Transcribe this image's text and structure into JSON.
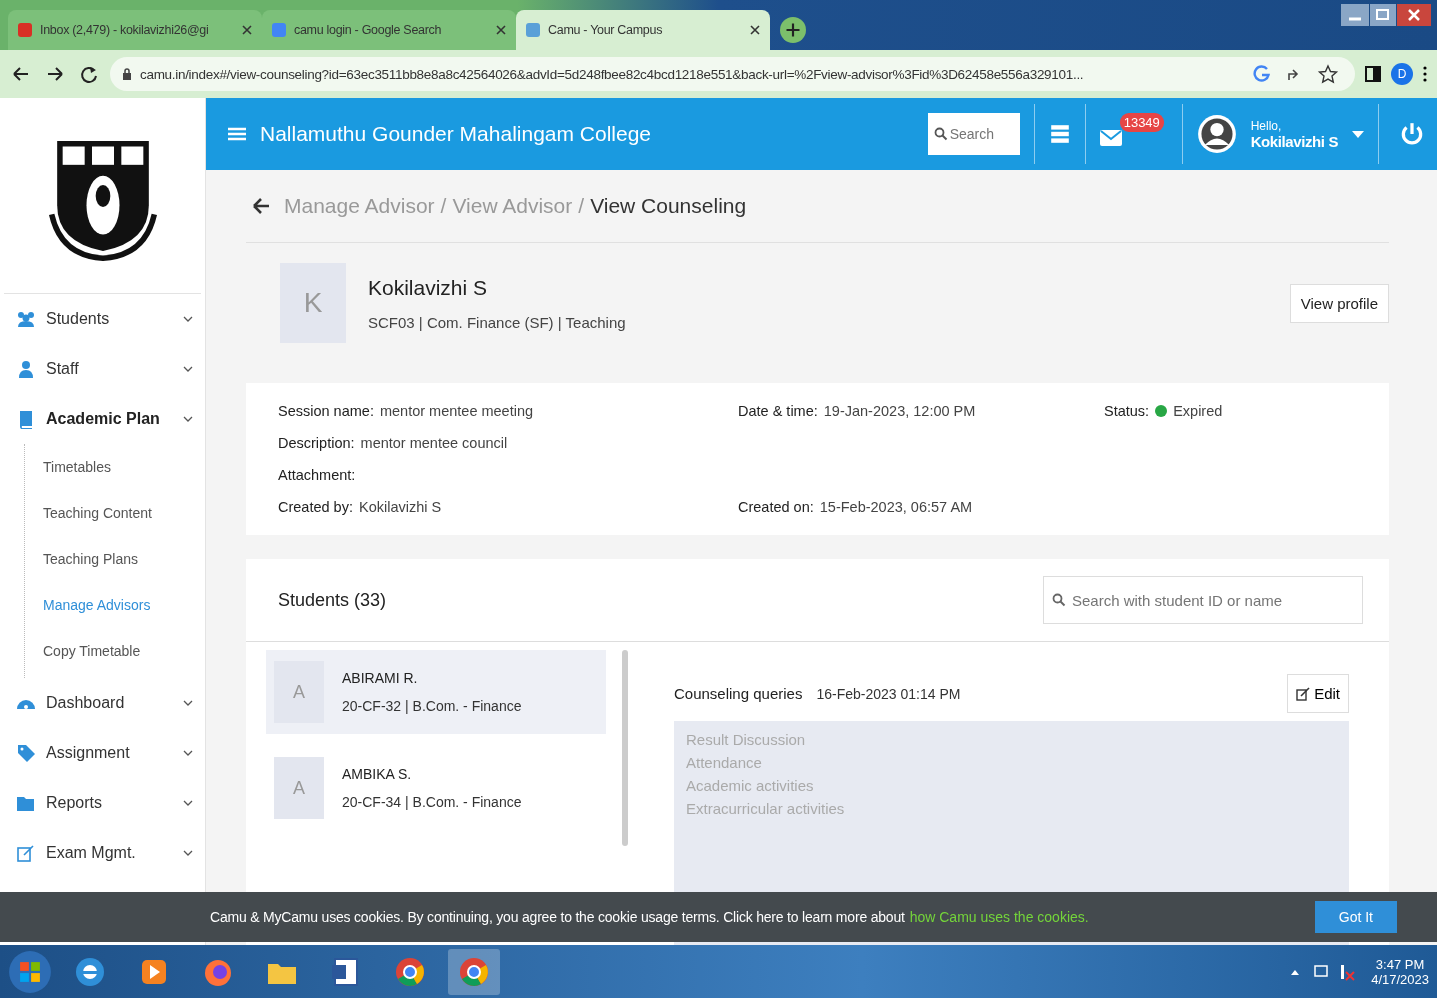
{
  "browser": {
    "tabs": [
      {
        "kind": "mail",
        "title": "Inbox (2,479) - kokilavizhi26@gi",
        "selected": false
      },
      {
        "kind": "google",
        "title": "camu login - Google Search",
        "selected": false
      },
      {
        "kind": "page",
        "title": "Camu - Your Campus",
        "selected": true
      }
    ],
    "url": "camu.in/index#/view-counseling?id=63ec3511bb8e8a8c42564026&advId=5d248fbee82c4bcd1218e551&back-url=%2Fview-advisor%3Fid%3D62458e556a329101...",
    "profile_initial": "D"
  },
  "header": {
    "college": "Nallamuthu Gounder Mahalingam College",
    "search": {
      "placeholder": "Search"
    },
    "mail_count": "13349",
    "greeting": "Hello,",
    "user": "Kokilavizhi S"
  },
  "sidebar": {
    "items": [
      {
        "kind": "people",
        "label": "Students",
        "expanded": false
      },
      {
        "kind": "person",
        "label": "Staff",
        "expanded": false
      },
      {
        "kind": "book",
        "label": "Academic Plan",
        "expanded": true,
        "children": [
          {
            "label": "Timetables",
            "selected": false
          },
          {
            "label": "Teaching Content",
            "selected": false
          },
          {
            "label": "Teaching Plans",
            "selected": false
          },
          {
            "label": "Manage Advisors",
            "selected": true
          },
          {
            "label": "Copy Timetable",
            "selected": false
          }
        ]
      },
      {
        "kind": "dashboard",
        "label": "Dashboard",
        "expanded": false
      },
      {
        "kind": "tag",
        "label": "Assignment",
        "expanded": false
      },
      {
        "kind": "folder",
        "label": "Reports",
        "expanded": false
      },
      {
        "kind": "edit",
        "label": "Exam Mgmt.",
        "expanded": false
      }
    ]
  },
  "breadcrumb": {
    "separator": "/",
    "items": [
      "Manage Advisor",
      "View Advisor",
      "View Counseling"
    ]
  },
  "advisor": {
    "initial": "K",
    "name": "Kokilavizhi S",
    "details": "SCF03 | Com. Finance (SF) | Teaching",
    "button": "View profile"
  },
  "session": {
    "fields": [
      {
        "label": "Session name:",
        "value": "mentor mentee meeting"
      },
      {
        "label": "Date & time:",
        "value": "19-Jan-2023, 12:00 PM"
      },
      {
        "label": "Status:",
        "value": "Expired",
        "color": "#28a745"
      },
      {
        "label": "Description:",
        "value": "mentor mentee council"
      },
      {
        "label": "Attachment:"
      },
      {
        "label": "Created by:",
        "value": "Kokilavizhi S"
      },
      {
        "label": "Created on:",
        "value": "15-Feb-2023, 06:57 AM"
      }
    ]
  },
  "students": {
    "title": "Students (33)",
    "search": {
      "placeholder": "Search with student ID or name"
    },
    "list": [
      {
        "initial": "A",
        "name": "ABIRAMI R.",
        "details": "20-CF-32 | B.Com. - Finance",
        "selected": true
      },
      {
        "initial": "A",
        "name": "AMBIKA S.",
        "details": "20-CF-34 | B.Com. - Finance",
        "selected": false
      }
    ]
  },
  "queries": {
    "title": "Counseling queries",
    "date": "16-Feb-2023 01:14 PM",
    "edit": "Edit",
    "items": [
      "Result Discussion",
      "Attendance",
      "Academic activities",
      "Extracurricular activities"
    ]
  },
  "cookie": {
    "text": "Camu & MyCamu uses cookies. By continuing, you agree to the cookie usage terms. Click here to learn more about",
    "link": "how Camu uses the cookies.",
    "button": "Got It"
  },
  "taskbar": {
    "time": "3:47 PM",
    "date": "4/17/2023"
  }
}
